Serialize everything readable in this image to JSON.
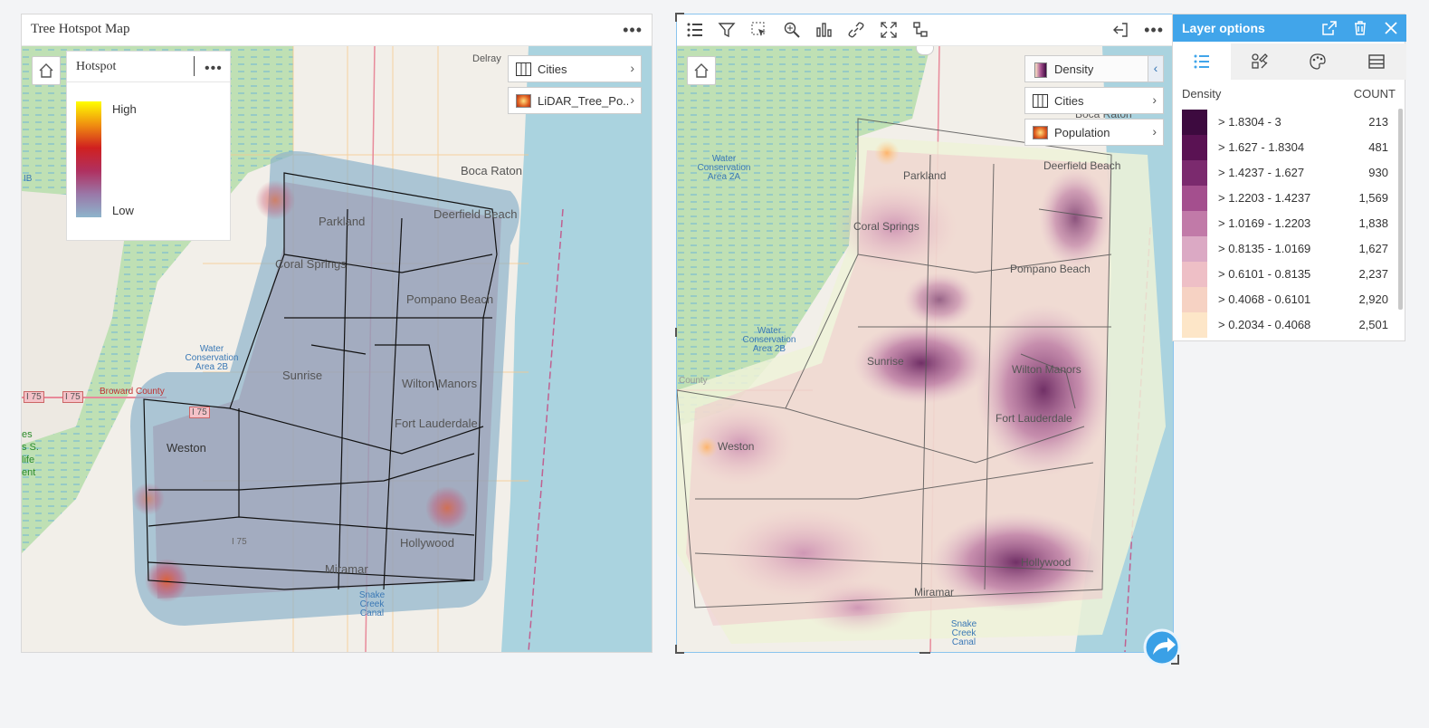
{
  "left_card": {
    "title": "Tree Hotspot Map",
    "legend": {
      "title": "Hotspot",
      "high": "High",
      "low": "Low"
    },
    "layers": [
      {
        "name": "Cities",
        "icon": "cities-icon"
      },
      {
        "name": "LiDAR_Tree_Po...",
        "icon": "heatmap-icon"
      }
    ],
    "labels": {
      "delray": "Delray",
      "boca": "Boca Raton",
      "deerfield": "Deerfield Beach",
      "parkland": "Parkland",
      "coral": "Coral Springs",
      "pompano": "Pompano Beach",
      "sunrise": "Sunrise",
      "wilton": "Wilton Manors",
      "ftl": "Fort Lauderdale",
      "weston": "Weston",
      "hollywood": "Hollywood",
      "miramar": "Miramar",
      "wca2b": "Water Conservation Area 2B",
      "broward": "Broward County",
      "i75a": "I 75",
      "i75b": "I 75",
      "i75c": "I 75",
      "i75d": "I 75",
      "snake": "Snake Creek Canal",
      "ib": "IB",
      "left_partial": "es\ns S.\nlife\nent"
    }
  },
  "right_card": {
    "layers": [
      {
        "name": "Density",
        "icon": "density-icon"
      },
      {
        "name": "Cities",
        "icon": "cities-icon"
      },
      {
        "name": "Population",
        "icon": "heatmap-icon"
      }
    ],
    "labels": {
      "boca": "Boca Raton",
      "deerfield": "Deerfield Beach",
      "parkland": "Parkland",
      "coral": "Coral Springs",
      "pompano": "Pompano Beach",
      "sunrise": "Sunrise",
      "wilton": "Wilton Manors",
      "ftl": "Fort Lauderdale",
      "weston": "Weston",
      "hollywood": "Hollywood",
      "miramar": "Miramar",
      "wca2a": "Water Conservation Area 2A",
      "wca2b": "Water Conservation Area 2B",
      "county": "County",
      "snake": "Snake Creek Canal"
    }
  },
  "layer_options": {
    "title": "Layer options",
    "field_label": "Density",
    "count_label": "COUNT",
    "classes": [
      {
        "range": "> 1.8304 - 3",
        "count": "213",
        "color": "#3d0a3f"
      },
      {
        "range": "> 1.627 - 1.8304",
        "count": "481",
        "color": "#5a1253"
      },
      {
        "range": "> 1.4237 - 1.627",
        "count": "930",
        "color": "#7b2a6e"
      },
      {
        "range": "> 1.2203 - 1.4237",
        "count": "1,569",
        "color": "#a44f8e"
      },
      {
        "range": "> 1.0169 - 1.2203",
        "count": "1,838",
        "color": "#c17aa8"
      },
      {
        "range": "> 0.8135 - 1.0169",
        "count": "1,627",
        "color": "#dba9c4"
      },
      {
        "range": "> 0.6101 - 0.8135",
        "count": "2,237",
        "color": "#eebfc6"
      },
      {
        "range": "> 0.4068 - 0.6101",
        "count": "2,920",
        "color": "#f6d2c3"
      },
      {
        "range": "> 0.2034 - 0.4068",
        "count": "2,501",
        "color": "#fde6c8"
      }
    ]
  },
  "colors": {
    "accent": "#41a5ea",
    "water": "#aad3df",
    "land": "#f2efe9",
    "wetland": "#b9dcb0",
    "hotspot_low": "#8db4cb",
    "hotspot_high": "#ffff00"
  }
}
